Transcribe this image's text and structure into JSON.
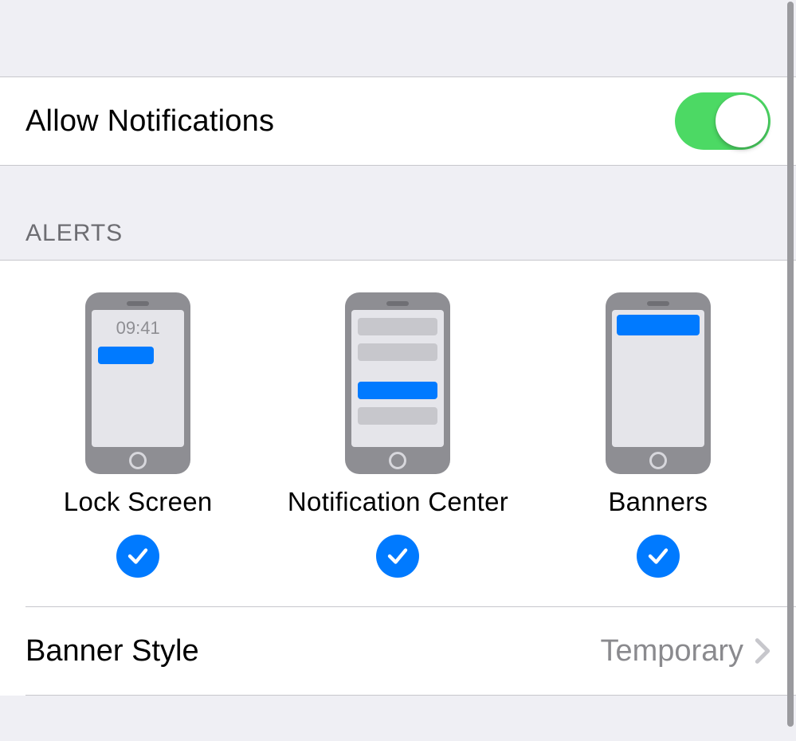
{
  "allow": {
    "label": "Allow Notifications",
    "on": true
  },
  "sections": {
    "alerts_header": "ALERTS"
  },
  "alerts": {
    "lock_screen": {
      "label": "Lock Screen",
      "time": "09:41",
      "checked": true
    },
    "notification_center": {
      "label": "Notification Center",
      "checked": true
    },
    "banners": {
      "label": "Banners",
      "checked": true
    }
  },
  "banner_style": {
    "label": "Banner Style",
    "value": "Temporary"
  },
  "colors": {
    "accent": "#007AFF",
    "switch_on": "#4CD964"
  }
}
